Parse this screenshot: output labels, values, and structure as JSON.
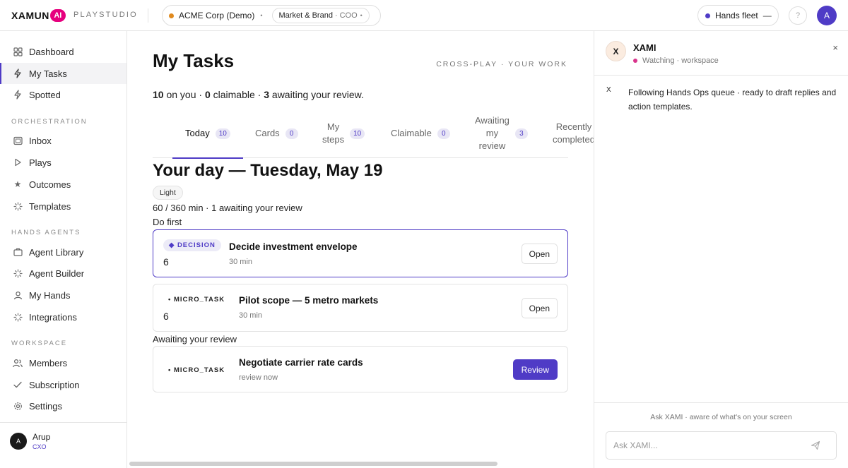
{
  "header": {
    "logo_word": "XAMUN",
    "logo_ai": "AI",
    "studio": "PLAYSTUDIO",
    "org": {
      "name": "ACME Corp (Demo)",
      "dot_color": "#e08a1e"
    },
    "context": {
      "label": "Market & Brand",
      "role": "COO"
    },
    "separator": "·",
    "fleet": {
      "label": "Hands fleet",
      "value": "—",
      "dot_color": "#4f3bc6"
    },
    "help": "?",
    "avatar_initial": "A"
  },
  "sidebar": {
    "primary": [
      {
        "label": "Dashboard",
        "icon": "grid-icon"
      },
      {
        "label": "My Tasks",
        "icon": "bolt-icon",
        "active": true
      },
      {
        "label": "Spotted",
        "icon": "bolt-icon"
      }
    ],
    "orchestration_label": "ORCHESTRATION",
    "orchestration": [
      {
        "label": "Inbox",
        "icon": "inbox-icon"
      },
      {
        "label": "Plays",
        "icon": "play-icon"
      },
      {
        "label": "Outcomes",
        "icon": "star-icon"
      },
      {
        "label": "Templates",
        "icon": "spinner-icon"
      }
    ],
    "agents_label": "HANDS AGENTS",
    "agents": [
      {
        "label": "Agent Library",
        "icon": "briefcase-icon"
      },
      {
        "label": "Agent Builder",
        "icon": "spinner-icon"
      },
      {
        "label": "My Hands",
        "icon": "user-icon"
      },
      {
        "label": "Integrations",
        "icon": "spinner-icon"
      }
    ],
    "workspace_label": "WORKSPACE",
    "workspace": [
      {
        "label": "Members",
        "icon": "users-icon"
      },
      {
        "label": "Subscription",
        "icon": "check-icon"
      },
      {
        "label": "Settings",
        "icon": "gear-icon"
      }
    ],
    "user": {
      "initial": "A",
      "name": "Arup",
      "role": "CXO"
    }
  },
  "main": {
    "title": "My Tasks",
    "crossplay": "CROSS-PLAY · YOUR WORK",
    "summary": {
      "on_you": "10",
      "on_you_label": " on you · ",
      "claimable": "0",
      "claimable_label": " claimable · ",
      "awaiting": "3",
      "awaiting_label": " awaiting your review."
    },
    "tabs": [
      {
        "label": "Today",
        "count": "10",
        "active": true
      },
      {
        "label": "Cards",
        "count": "0"
      },
      {
        "label": "My\nsteps",
        "count": "10"
      },
      {
        "label": "Claimable",
        "count": "0"
      },
      {
        "label": "Awaiting\nmy\nreview",
        "count": "3"
      },
      {
        "label": "Recently\ncompleted",
        "count": ""
      }
    ],
    "day_title": "Your day — Tuesday, May 19",
    "load_pill": "Light",
    "meta": "60 / 360 min · 1 awaiting your review",
    "do_first_label": "Do first",
    "awaiting_label": "Awaiting your review",
    "cards": [
      {
        "kind": "◆ DECISION",
        "num": "6",
        "title": "Decide investment envelope",
        "sub": "30 min",
        "action": "Open"
      },
      {
        "kind": "• MICRO_TASK",
        "num": "6",
        "title": "Pilot scope — 5 metro markets",
        "sub": "30 min",
        "action": "Open"
      },
      {
        "kind": "• MICRO_TASK",
        "title": "Negotiate carrier rate cards",
        "sub": "review now",
        "action": "Review"
      }
    ]
  },
  "xami": {
    "avatar": "X",
    "name": "XAMI",
    "status": "Watching · workspace",
    "status_color": "#d9348c",
    "close": "×",
    "message_badge": "X",
    "message": "Following Hands Ops queue · ready to draft replies and action templates.",
    "ask_hint": "Ask XAMI · aware of what's on your screen",
    "input_placeholder": "Ask XAMI...",
    "input_value": ""
  },
  "colors": {
    "accent": "#4f3bc6",
    "logo_pink": "#e6007e"
  }
}
